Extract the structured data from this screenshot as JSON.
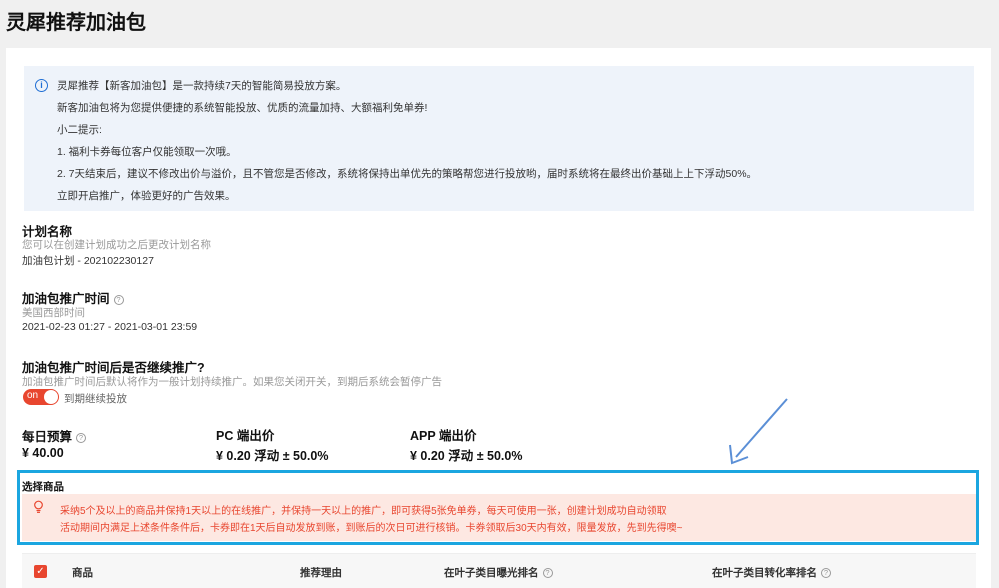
{
  "header": {
    "title": "灵犀推荐加油包"
  },
  "notice": {
    "lines": [
      "灵犀推荐【新客加油包】是一款持续7天的智能简易投放方案。",
      "新客加油包将为您提供便捷的系统智能投放、优质的流量加持、大额福利免单券!",
      "小二提示:",
      "1. 福利卡券每位客户仅能领取一次哦。",
      "2. 7天结束后，建议不修改出价与溢价，且不管您是否修改，系统将保持出单优先的策略帮您进行投放哟，届时系统将在最终出价基础上上下浮动50%。",
      "立即开启推广，体验更好的广告效果。"
    ]
  },
  "plan_name": {
    "title": "计划名称",
    "hint": "您可以在创建计划成功之后更改计划名称",
    "value": "加油包计划 - 202102230127"
  },
  "promo_time": {
    "title": "加油包推广时间",
    "timezone": "美国西部时间",
    "range": "2021-02-23 01:27 - 2021-03-01 23:59"
  },
  "continue": {
    "title": "加油包推广时间后是否继续推广?",
    "hint": "加油包推广时间后默认将作为一般计划持续推广。如果您关闭开关，到期后系统会暂停广告",
    "toggle_text": "on",
    "toggle_label": "到期继续投放"
  },
  "budget": {
    "daily_title": "每日预算",
    "daily_value": "¥ 40.00",
    "pc_title": "PC 端出价",
    "pc_value": "¥ 0.20 浮动 ± 50.0%",
    "app_title": "APP 端出价",
    "app_value": "¥ 0.20 浮动 ± 50.0%"
  },
  "select_goods": {
    "title": "选择商品",
    "promo_line1": "采纳5个及以上的商品并保持1天以上的在线推广，并保持一天以上的推广，即可获得5张免单券，每天可使用一张，创建计划成功自动领取",
    "promo_line2": "活动期间内满足上述条件条件后，卡券即在1天后自动发放到账，到账后的次日可进行核销。卡券领取后30天内有效，限量发放，先到先得噢~"
  },
  "table": {
    "headers": [
      "商品",
      "推荐理由",
      "在叶子类目曝光排名",
      "在叶子类目转化率排名"
    ]
  },
  "colors": {
    "accent": "#e8462f",
    "highlight_box": "#1ba6e0",
    "notice_bg": "#eef3fa"
  },
  "icons": {
    "info": "info-circle-icon",
    "help": "question-circle-icon",
    "bulb": "lightbulb-icon",
    "check": "checkbox-checked-icon"
  }
}
